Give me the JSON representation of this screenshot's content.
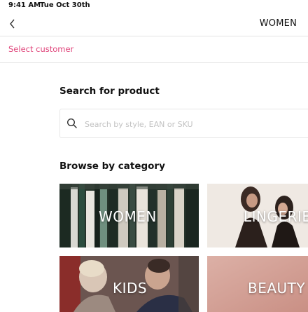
{
  "status_bar": {
    "time": "9:41 AM",
    "date": "Tue Oct 30th"
  },
  "nav": {
    "title": "WOMEN"
  },
  "customer": {
    "select_label": "Select customer"
  },
  "search": {
    "heading": "Search for product",
    "placeholder": "Search by style, EAN or SKU",
    "value": ""
  },
  "browse": {
    "heading": "Browse by category",
    "categories": [
      {
        "label": "WOMEN"
      },
      {
        "label": "LINGERIE"
      },
      {
        "label": "KIDS"
      },
      {
        "label": "BEAUTY"
      }
    ]
  },
  "colors": {
    "accent": "#e0457b",
    "divider": "#e4e4e4",
    "text": "#111111"
  }
}
